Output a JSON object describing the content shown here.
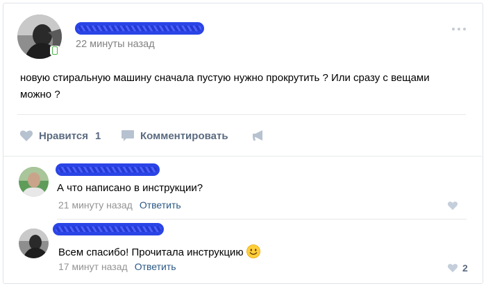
{
  "post": {
    "time": "22 минуты назад",
    "text": "новую стиральную машину сначала пустую нужно прокрутить ? Или сразу с вещами можно ?",
    "actions": {
      "like_label": "Нравится",
      "like_count": "1",
      "comment_label": "Комментировать"
    }
  },
  "comments": [
    {
      "text": "А что написано в инструкции?",
      "time": "21 минуту назад",
      "reply_label": "Ответить",
      "likes": ""
    },
    {
      "text": "Всем спасибо! Прочитала инструкцию",
      "time": "17 минут назад",
      "reply_label": "Ответить",
      "likes": "2"
    }
  ],
  "icons": {
    "heart": "heart-icon",
    "comment": "comment-bubble-icon",
    "share": "megaphone-icon",
    "more": "more-dots-icon",
    "mobile": "mobile-phone-icon",
    "emoji": "smiling-face-emoji"
  },
  "colors": {
    "accent_link": "#2a5885",
    "action_gray": "#5a6a80",
    "meta_gray": "#828282",
    "divider": "#e7e8ec",
    "redaction_blue": "#2a44e6"
  }
}
